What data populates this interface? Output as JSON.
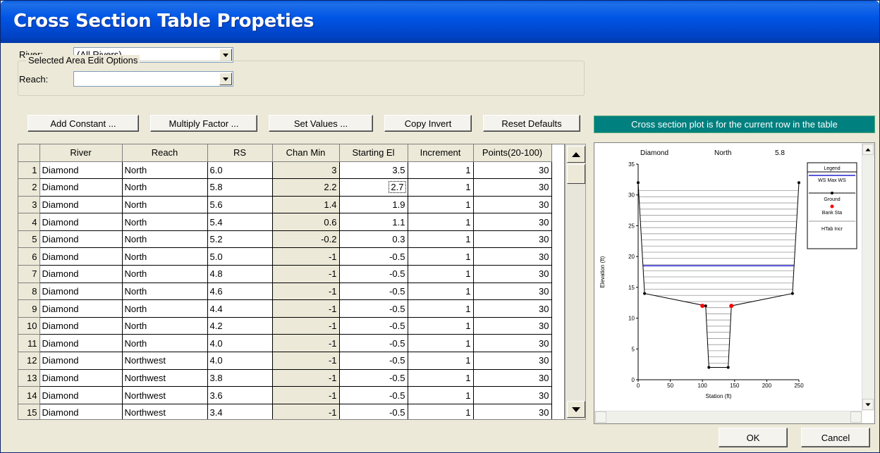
{
  "window": {
    "title": "Cross Section Table Propeties"
  },
  "filters": {
    "river_label": "River:",
    "river_value": "(All Rivers)",
    "reach_label": "Reach:",
    "reach_value": ""
  },
  "edit_options": {
    "group_label": "Selected Area Edit Options",
    "add_constant": "Add Constant ...",
    "multiply_factor": "Multiply Factor ...",
    "set_values": "Set Values ...",
    "copy_invert": "Copy Invert",
    "reset_defaults": "Reset Defaults"
  },
  "info_banner": "Cross section plot is for the current row in the table",
  "table": {
    "columns": [
      "River",
      "Reach",
      "RS",
      "Chan Min",
      "Starting El",
      "Increment",
      "Points(20-100)"
    ],
    "rows": [
      {
        "n": "1",
        "river": "Diamond",
        "reach": "North",
        "rs": "6.0",
        "chan_min": "3",
        "start_el": "3.5",
        "inc": "1",
        "points": "30"
      },
      {
        "n": "2",
        "river": "Diamond",
        "reach": "North",
        "rs": "5.8",
        "chan_min": "2.2",
        "start_el": "2.7",
        "inc": "1",
        "points": "30"
      },
      {
        "n": "3",
        "river": "Diamond",
        "reach": "North",
        "rs": "5.6",
        "chan_min": "1.4",
        "start_el": "1.9",
        "inc": "1",
        "points": "30"
      },
      {
        "n": "4",
        "river": "Diamond",
        "reach": "North",
        "rs": "5.4",
        "chan_min": "0.6",
        "start_el": "1.1",
        "inc": "1",
        "points": "30"
      },
      {
        "n": "5",
        "river": "Diamond",
        "reach": "North",
        "rs": "5.2",
        "chan_min": "-0.2",
        "start_el": "0.3",
        "inc": "1",
        "points": "30"
      },
      {
        "n": "6",
        "river": "Diamond",
        "reach": "North",
        "rs": "5.0",
        "chan_min": "-1",
        "start_el": "-0.5",
        "inc": "1",
        "points": "30"
      },
      {
        "n": "7",
        "river": "Diamond",
        "reach": "North",
        "rs": "4.8",
        "chan_min": "-1",
        "start_el": "-0.5",
        "inc": "1",
        "points": "30"
      },
      {
        "n": "8",
        "river": "Diamond",
        "reach": "North",
        "rs": "4.6",
        "chan_min": "-1",
        "start_el": "-0.5",
        "inc": "1",
        "points": "30"
      },
      {
        "n": "9",
        "river": "Diamond",
        "reach": "North",
        "rs": "4.4",
        "chan_min": "-1",
        "start_el": "-0.5",
        "inc": "1",
        "points": "30"
      },
      {
        "n": "10",
        "river": "Diamond",
        "reach": "North",
        "rs": "4.2",
        "chan_min": "-1",
        "start_el": "-0.5",
        "inc": "1",
        "points": "30"
      },
      {
        "n": "11",
        "river": "Diamond",
        "reach": "North",
        "rs": "4.0",
        "chan_min": "-1",
        "start_el": "-0.5",
        "inc": "1",
        "points": "30"
      },
      {
        "n": "12",
        "river": "Diamond",
        "reach": "Northwest",
        "rs": "4.0",
        "chan_min": "-1",
        "start_el": "-0.5",
        "inc": "1",
        "points": "30"
      },
      {
        "n": "13",
        "river": "Diamond",
        "reach": "Northwest",
        "rs": "3.8",
        "chan_min": "-1",
        "start_el": "-0.5",
        "inc": "1",
        "points": "30"
      },
      {
        "n": "14",
        "river": "Diamond",
        "reach": "Northwest",
        "rs": "3.6",
        "chan_min": "-1",
        "start_el": "-0.5",
        "inc": "1",
        "points": "30"
      },
      {
        "n": "15",
        "river": "Diamond",
        "reach": "Northwest",
        "rs": "3.4",
        "chan_min": "-1",
        "start_el": "-0.5",
        "inc": "1",
        "points": "30"
      }
    ],
    "focused_row": 2
  },
  "plot": {
    "header_river": "Diamond",
    "header_reach": "North",
    "header_rs": "5.8",
    "xlabel": "Station (ft)",
    "ylabel": "Elevation (ft)",
    "legend_title": "Legend",
    "legend_items": [
      "WS Max WS",
      "Ground",
      "Bank Sta",
      "HTab Incr"
    ],
    "colors": {
      "ws": "#2222cc",
      "ground": "#000000",
      "bank": "#ff0000",
      "htab": "#999999"
    }
  },
  "chart_data": {
    "type": "line",
    "xlabel": "Station (ft)",
    "ylabel": "Elevation (ft)",
    "xlim": [
      0,
      250
    ],
    "ylim": [
      0,
      35
    ],
    "xticks": [
      "0",
      "50",
      "100",
      "150",
      "200",
      "250"
    ],
    "yticks": [
      "0",
      "5",
      "10",
      "15",
      "20",
      "25",
      "30",
      "35"
    ],
    "ground": {
      "x": [
        0,
        10,
        105,
        110,
        140,
        145,
        240,
        250
      ],
      "y": [
        32,
        14,
        12,
        2,
        2,
        12,
        14,
        32
      ]
    },
    "bank_stations": {
      "x": [
        100,
        145
      ],
      "y": [
        12,
        12
      ]
    },
    "ws_max": 18.5,
    "htab_start": 2.7,
    "htab_increment": 1
  },
  "buttons": {
    "ok": "OK",
    "cancel": "Cancel"
  }
}
